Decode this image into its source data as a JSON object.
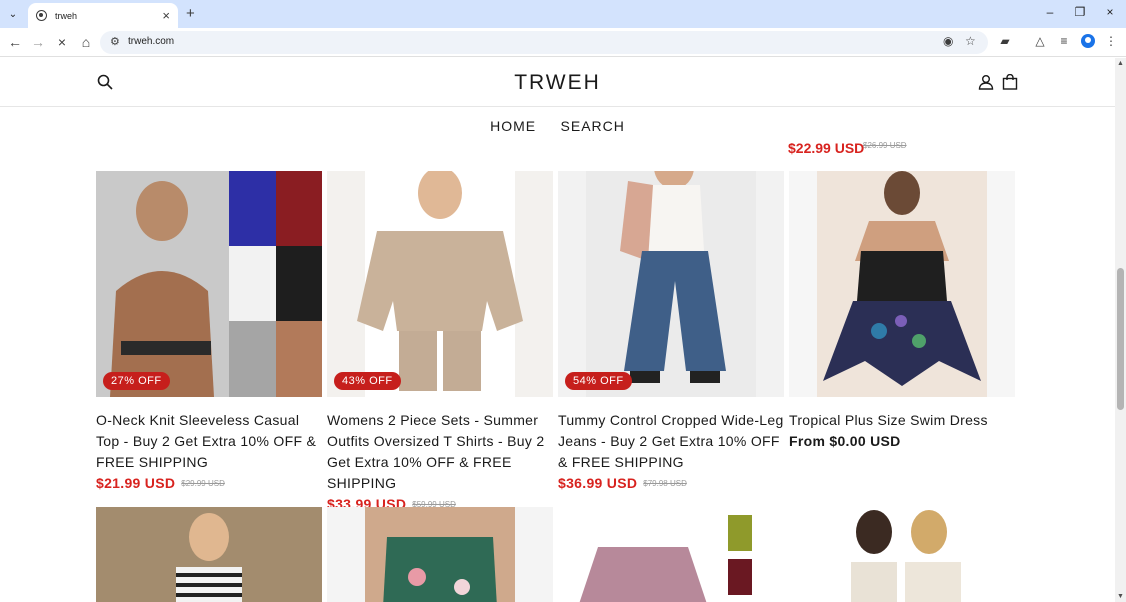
{
  "browser": {
    "tab_title": "trweh",
    "url": "trweh.com",
    "new_tab_icon": "plus-icon"
  },
  "store": {
    "logo": "TRWEH",
    "nav": [
      "HOME",
      "SEARCH"
    ],
    "prev_row": {
      "price": "$22.99 USD",
      "compare": "$26.99 USD"
    }
  },
  "products": [
    {
      "name": "O-Neck Knit Sleeveless Casual Top - Buy 2 Get Extra 10% OFF & FREE SHIPPING",
      "price": "$21.99 USD",
      "compare": "$29.99 USD",
      "badge": "27% OFF"
    },
    {
      "name": "Womens 2 Piece Sets - Summer Outfits Oversized T Shirts - Buy 2 Get Extra 10% OFF & FREE SHIPPING",
      "price": "$33.99 USD",
      "compare": "$59.99 USD",
      "badge": "43% OFF"
    },
    {
      "name": "Tummy Control Cropped Wide-Leg Jeans - Buy 2 Get Extra 10% OFF & FREE SHIPPING",
      "price": "$36.99 USD",
      "compare": "$79.98 USD",
      "badge": "54% OFF"
    },
    {
      "name": "Tropical Plus Size Swim Dress",
      "price": "From $0.00 USD",
      "compare": "",
      "badge": ""
    }
  ],
  "colors": {
    "sale": "#d8231f",
    "badge": "#c61f1c",
    "tabstrip": "#d3e3fd"
  }
}
